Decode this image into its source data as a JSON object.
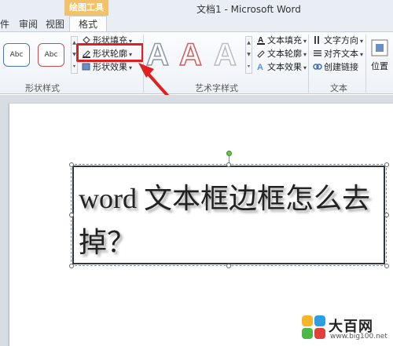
{
  "window": {
    "title": "文档1 - Microsoft Word",
    "context_tab_group": "绘图工具"
  },
  "tabs": [
    {
      "label": "件"
    },
    {
      "label": "审阅"
    },
    {
      "label": "视图"
    },
    {
      "label": "格式",
      "active": true
    }
  ],
  "ribbon": {
    "shape_styles": {
      "label": "形状样式",
      "samples": [
        "Abc",
        "Abc"
      ],
      "fill": "形状填充",
      "outline": "形状轮廓",
      "effects": "形状效果"
    },
    "wordart_styles": {
      "label": "艺术字样式",
      "letters": [
        "A",
        "A",
        "A"
      ],
      "text_fill": "文本填充",
      "text_outline": "文本轮廓",
      "text_effects": "文本效果"
    },
    "text": {
      "label": "文本",
      "direction": "文字方向",
      "align": "对齐文本",
      "link": "创建链接"
    },
    "position": {
      "label": "位置"
    }
  },
  "document": {
    "textbox_line1": "word 文本框边框怎么去",
    "textbox_line2": "掉？"
  },
  "watermark": {
    "name": "大百网",
    "url": "www.big100.net"
  },
  "colors": {
    "highlight_red": "#e02020",
    "context_tab": "#f2c26a"
  }
}
